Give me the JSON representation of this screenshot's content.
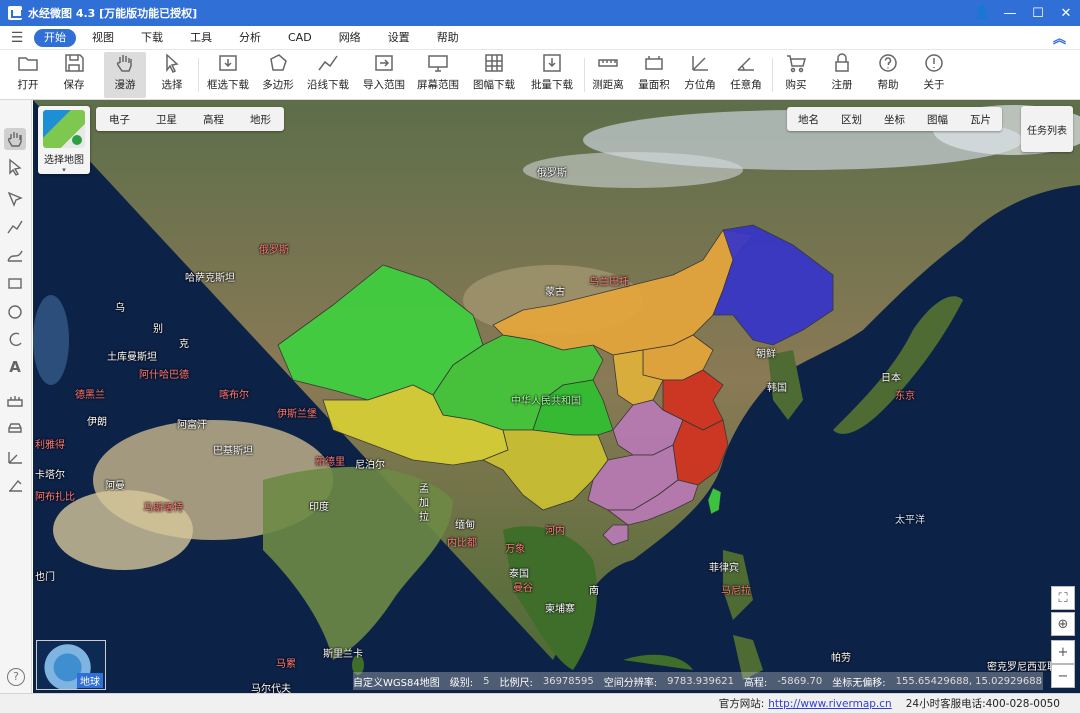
{
  "window": {
    "title": "水经微图 4.3 [万能版功能已授权]",
    "buttons": {
      "user": "👤",
      "minimize": "—",
      "maximize": "☐",
      "close": "✕"
    }
  },
  "menu": {
    "hamburger": "☰",
    "items": [
      "开始",
      "视图",
      "下载",
      "工具",
      "分析",
      "CAD",
      "网络",
      "设置",
      "帮助"
    ],
    "active_index": 0,
    "collapse": "︽"
  },
  "ribbon": [
    {
      "label": "打开",
      "icon": "folder-icon"
    },
    {
      "label": "保存",
      "icon": "save-icon"
    },
    {
      "label": "漫游",
      "icon": "hand-icon"
    },
    {
      "label": "选择",
      "icon": "cursor-icon"
    },
    {
      "label": "框选下载",
      "icon": "rect-download-icon"
    },
    {
      "label": "多边形",
      "icon": "polygon-icon"
    },
    {
      "label": "沿线下载",
      "icon": "line-download-icon"
    },
    {
      "label": "导入范围",
      "icon": "import-range-icon"
    },
    {
      "label": "屏幕范围",
      "icon": "screen-range-icon"
    },
    {
      "label": "图幅下载",
      "icon": "sheet-download-icon"
    },
    {
      "label": "批量下载",
      "icon": "batch-download-icon"
    },
    {
      "label": "测距离",
      "icon": "ruler-icon"
    },
    {
      "label": "量面积",
      "icon": "area-icon"
    },
    {
      "label": "方位角",
      "icon": "azimuth-icon"
    },
    {
      "label": "任意角",
      "icon": "angle-icon"
    },
    {
      "label": "购买",
      "icon": "cart-icon"
    },
    {
      "label": "注册",
      "icon": "lock-icon"
    },
    {
      "label": "帮助",
      "icon": "help-icon"
    },
    {
      "label": "关于",
      "icon": "info-icon"
    }
  ],
  "map_controls": {
    "select_map": "选择地图",
    "select_map_caret": "▾",
    "map_types": [
      "电子",
      "卫星",
      "高程",
      "地形"
    ],
    "overlays": [
      "地名",
      "区划",
      "坐标",
      "图幅",
      "瓦片"
    ],
    "task_list": "任务列表",
    "minimap_label": "地球",
    "zoom_in": "+",
    "zoom_out": "−",
    "locate": "⊕",
    "fullscreen": "⛶",
    "help": "?"
  },
  "map_labels": [
    {
      "text": "俄罗斯",
      "color": "w"
    },
    {
      "text": "俄罗斯",
      "color": "r"
    },
    {
      "text": "乌兰巴托",
      "color": "r"
    },
    {
      "text": "蒙古",
      "color": "w"
    },
    {
      "text": "哈萨克斯坦",
      "color": "w"
    },
    {
      "text": "乌",
      "color": "w"
    },
    {
      "text": "别",
      "color": "w"
    },
    {
      "text": "克",
      "color": "w"
    },
    {
      "text": "土库曼斯坦",
      "color": "w"
    },
    {
      "text": "阿什哈巴德",
      "color": "r"
    },
    {
      "text": "喀布尔",
      "color": "r"
    },
    {
      "text": "德黑兰",
      "color": "r"
    },
    {
      "text": "伊朗",
      "color": "w"
    },
    {
      "text": "阿富汗",
      "color": "w"
    },
    {
      "text": "伊斯兰堡",
      "color": "r"
    },
    {
      "text": "巴基斯坦",
      "color": "w"
    },
    {
      "text": "新德里",
      "color": "r"
    },
    {
      "text": "尼泊尔",
      "color": "w"
    },
    {
      "text": "印度",
      "color": "w"
    },
    {
      "text": "孟",
      "color": "w"
    },
    {
      "text": "加",
      "color": "w"
    },
    {
      "text": "拉",
      "color": "w"
    },
    {
      "text": "缅甸",
      "color": "w"
    },
    {
      "text": "内比都",
      "color": "r"
    },
    {
      "text": "河内",
      "color": "r"
    },
    {
      "text": "万象",
      "color": "r"
    },
    {
      "text": "泰国",
      "color": "w"
    },
    {
      "text": "曼谷",
      "color": "r"
    },
    {
      "text": "柬埔寨",
      "color": "w"
    },
    {
      "text": "南",
      "color": "w"
    },
    {
      "text": "中华人民共和国",
      "color": "g"
    },
    {
      "text": "朝鲜",
      "color": "w"
    },
    {
      "text": "韩国",
      "color": "w"
    },
    {
      "text": "日本",
      "color": "w"
    },
    {
      "text": "东京",
      "color": "r"
    },
    {
      "text": "太平洋",
      "color": "b"
    },
    {
      "text": "菲律宾",
      "color": "w"
    },
    {
      "text": "马尼拉",
      "color": "r"
    },
    {
      "text": "帕劳",
      "color": "w"
    },
    {
      "text": "密克罗尼西亚联",
      "color": "w"
    },
    {
      "text": "斯里兰卡",
      "color": "w"
    },
    {
      "text": "马累",
      "color": "r"
    },
    {
      "text": "马尔代夫",
      "color": "w"
    },
    {
      "text": "卡塔尔",
      "color": "w"
    },
    {
      "text": "阿布扎比",
      "color": "r"
    },
    {
      "text": "阿曼",
      "color": "w"
    },
    {
      "text": "马斯喀特",
      "color": "r"
    },
    {
      "text": "也门",
      "color": "w"
    },
    {
      "text": "利雅得",
      "color": "r"
    }
  ],
  "map_status": {
    "crs": "自定义WGS84地图",
    "level_label": "级别:",
    "level": "5",
    "scale_label": "比例尺:",
    "scale": "36978595",
    "res_label": "空间分辨率:",
    "res": "9783.939621",
    "elev_label": "高程:",
    "elev": "-5869.70",
    "coord_label": "坐标无偏移:",
    "coord": "155.65429688, 15.02929688"
  },
  "statusbar": {
    "site_label": "官方网站:",
    "site_url": "http://www.rivermap.cn",
    "phone_label": "24小时客服电话:",
    "phone": "400-028-0050"
  }
}
